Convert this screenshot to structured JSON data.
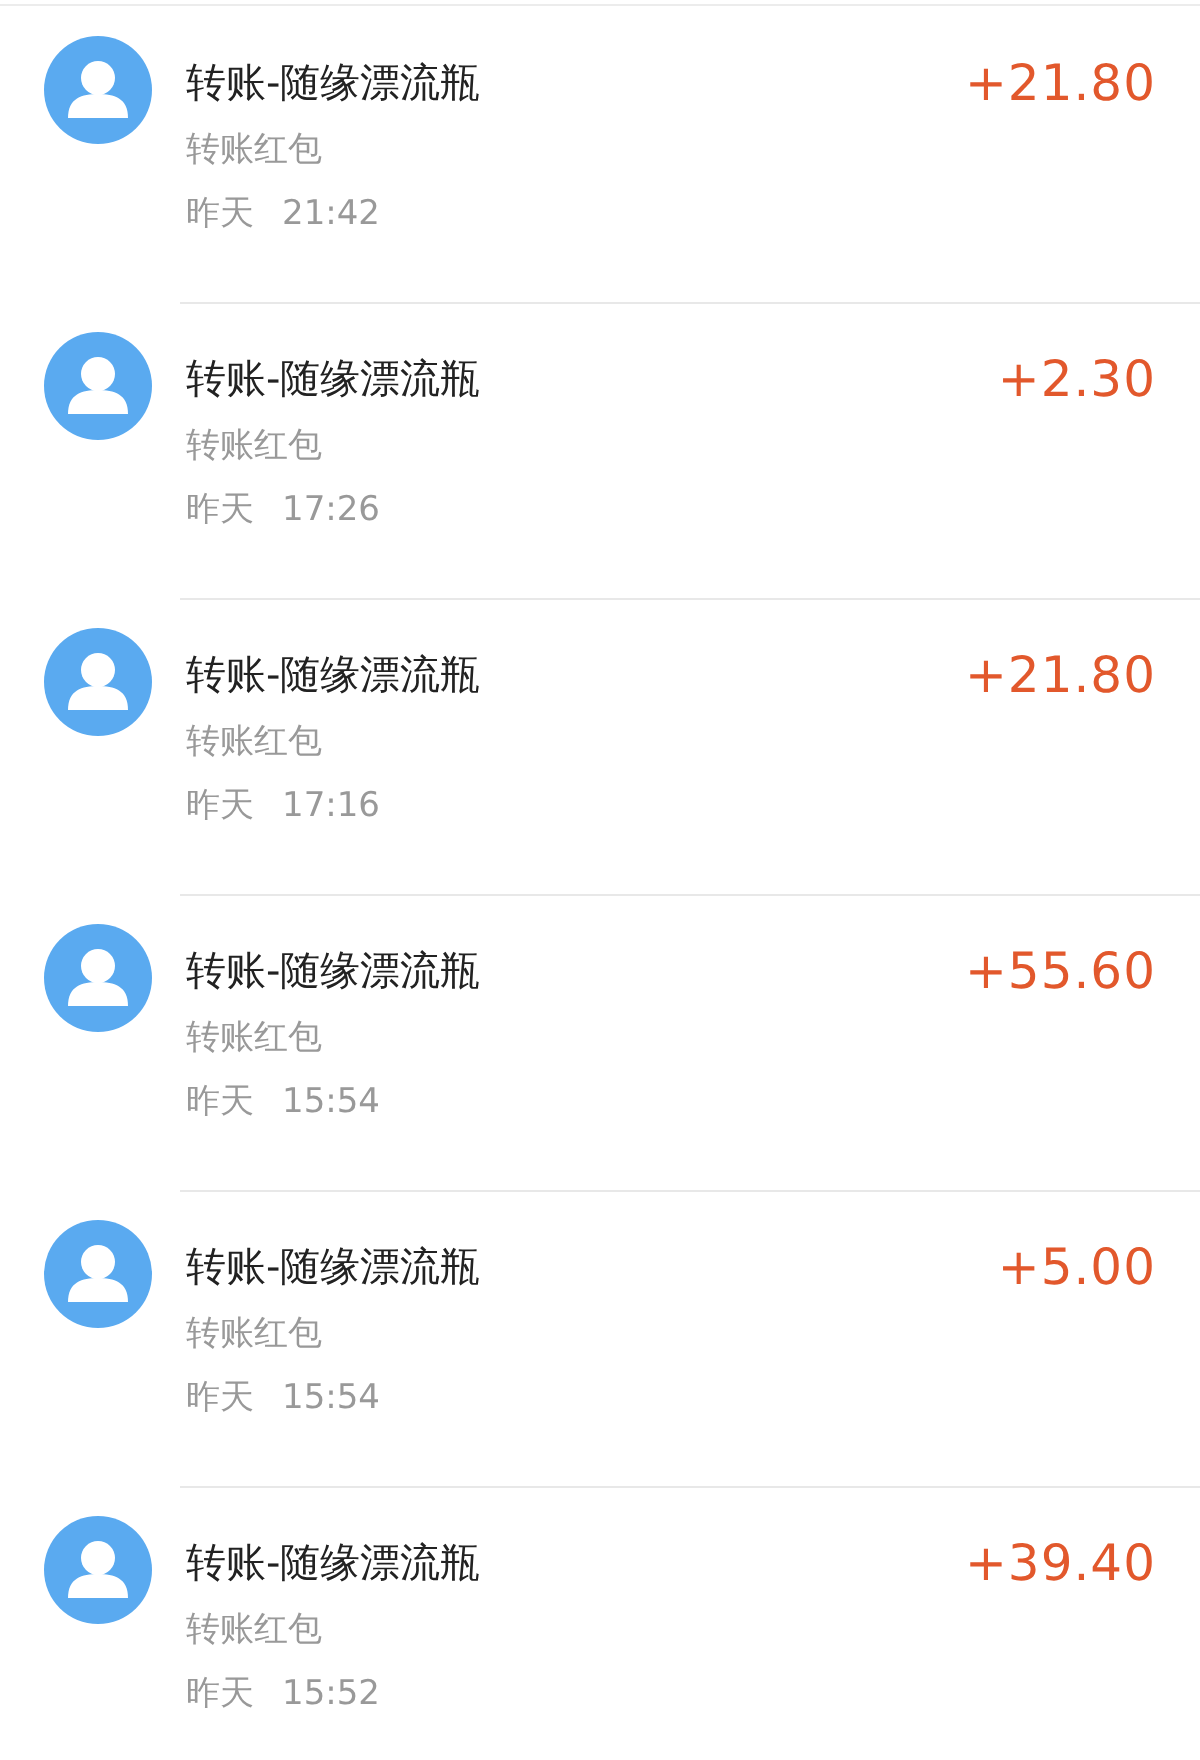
{
  "transactions": [
    {
      "title": "转账-随缘漂流瓶",
      "subtitle": "转账红包",
      "date": "昨天",
      "time": "21:42",
      "amount": "+21.80"
    },
    {
      "title": "转账-随缘漂流瓶",
      "subtitle": "转账红包",
      "date": "昨天",
      "time": "17:26",
      "amount": "+2.30"
    },
    {
      "title": "转账-随缘漂流瓶",
      "subtitle": "转账红包",
      "date": "昨天",
      "time": "17:16",
      "amount": "+21.80"
    },
    {
      "title": "转账-随缘漂流瓶",
      "subtitle": "转账红包",
      "date": "昨天",
      "time": "15:54",
      "amount": "+55.60"
    },
    {
      "title": "转账-随缘漂流瓶",
      "subtitle": "转账红包",
      "date": "昨天",
      "time": "15:54",
      "amount": "+5.00"
    },
    {
      "title": "转账-随缘漂流瓶",
      "subtitle": "转账红包",
      "date": "昨天",
      "time": "15:52",
      "amount": "+39.40"
    }
  ]
}
